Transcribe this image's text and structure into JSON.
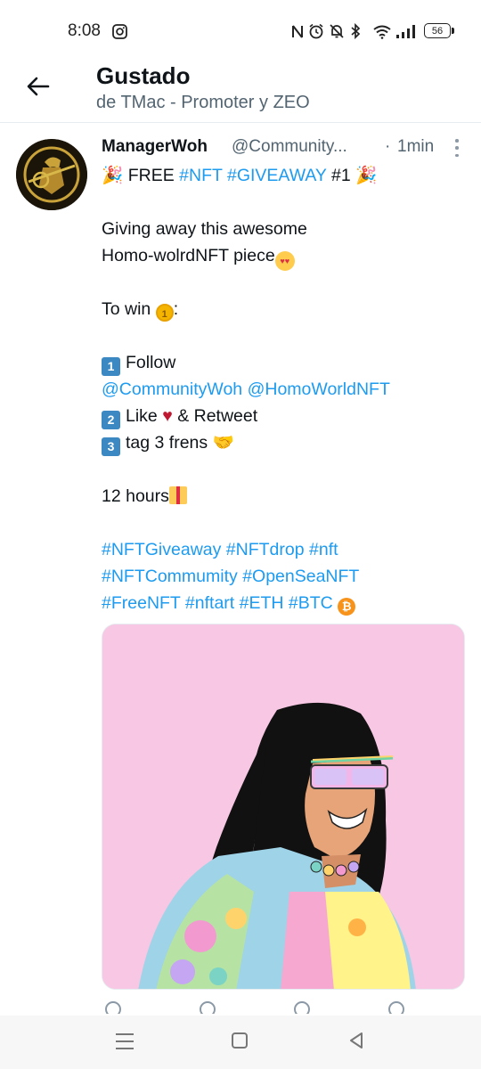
{
  "status_bar": {
    "time": "8:08",
    "battery": "56",
    "icons": [
      "instagram-icon",
      "nfc-icon",
      "alarm-icon",
      "mute-bell-icon",
      "bluetooth-icon",
      "wifi-icon",
      "signal-icon",
      "battery-icon"
    ]
  },
  "header": {
    "title": "Gustado",
    "subtitle": "de TMac - Promoter y ZEO"
  },
  "tweet": {
    "author_name": "ManagerWoh",
    "author_handle": "@Community...",
    "separator": "·",
    "time": "1min",
    "line1": {
      "pre": "FREE ",
      "tag1": "#NFT",
      "tag2": "#GIVEAWAY",
      "post": " #1"
    },
    "line2": "Giving away this awesome",
    "line3": "Homo-wolrdNFT piece",
    "line4": "To win",
    "line4_post": ":",
    "step1_key": "1",
    "step1": "Follow",
    "mentions": {
      "m1": "@CommunityWoh",
      "m2": "@HomoWorldNFT"
    },
    "step2_key": "2",
    "step2_pre": "Like",
    "step2_post": "& Retweet",
    "step3_key": "3",
    "step3": "tag 3 frens",
    "duration": "12 hours",
    "hashtags": {
      "h1": "#NFTGiveaway",
      "h2": "#NFTdrop",
      "h3": "#nft",
      "h4": "#NFTCommumity",
      "h5": "#OpenSeaNFT",
      "h6": "#FreeNFT",
      "h7": "#nftart",
      "h8": "#ETH",
      "h9": "#BTC"
    }
  },
  "colors": {
    "link": "#1d9bf0",
    "media_background": "#f7c7e3",
    "secondary_text": "#536471"
  }
}
